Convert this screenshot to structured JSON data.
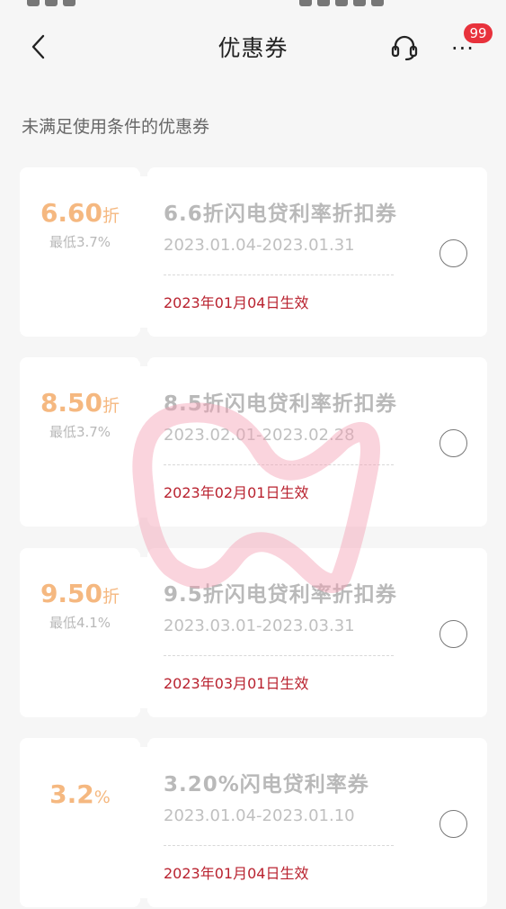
{
  "header": {
    "title": "优惠券",
    "badge_count": "99",
    "back_icon": "chevron-left-icon",
    "support_icon": "headset-icon",
    "more_icon": "more-dots-icon",
    "more_glyph": "···",
    "badge_color": "#e8323c"
  },
  "section": {
    "label": "未满足使用条件的优惠券"
  },
  "coupons": [
    {
      "discount": "6.60",
      "unit": "折",
      "min_rate": "最低3.7%",
      "name": "6.6折闪电贷利率折扣券",
      "range": "2023.01.04-2023.01.31",
      "effective": "2023年01月04日生效"
    },
    {
      "discount": "8.50",
      "unit": "折",
      "min_rate": "最低3.7%",
      "name": "8.5折闪电贷利率折扣券",
      "range": "2023.02.01-2023.02.28",
      "effective": "2023年02月01日生效"
    },
    {
      "discount": "9.50",
      "unit": "折",
      "min_rate": "最低4.1%",
      "name": "9.5折闪电贷利率折扣券",
      "range": "2023.03.01-2023.03.31",
      "effective": "2023年03月01日生效"
    },
    {
      "discount": "3.2",
      "unit": "%",
      "min_rate": "",
      "name": "3.20%闪电贷利率券",
      "range": "2023.01.04-2023.01.10",
      "effective": "2023年01月04日生效"
    }
  ],
  "colors": {
    "discount": "#f5b880",
    "effective": "#b9222f",
    "watermark": "#f3a0b4"
  }
}
